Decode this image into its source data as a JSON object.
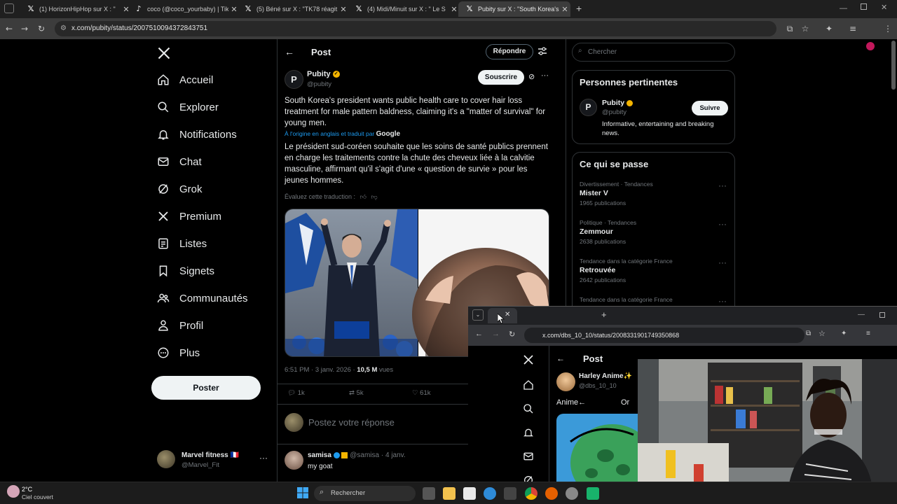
{
  "browser": {
    "tabs": [
      {
        "title": "(1) HorizonHipHop sur X : \"",
        "icon": "x-icon"
      },
      {
        "title": "coco (@coco_yourbaby) | TikTok",
        "icon": "tiktok-icon"
      },
      {
        "title": "(5) Béné sur X : \"TK78 réagit à l",
        "icon": "x-icon"
      },
      {
        "title": "(4) Midi/Minuit sur X : \" Le S",
        "icon": "x-icon"
      },
      {
        "title": "Pubity sur X : \"South Korea's pr",
        "icon": "x-icon"
      }
    ],
    "url": "x.com/pubity/status/2007510094372843751"
  },
  "sidebar": {
    "items": [
      {
        "label": "Accueil",
        "icon": "home-icon"
      },
      {
        "label": "Explorer",
        "icon": "search-icon"
      },
      {
        "label": "Notifications",
        "icon": "bell-icon"
      },
      {
        "label": "Chat",
        "icon": "mail-icon"
      },
      {
        "label": "Grok",
        "icon": "grok-icon"
      },
      {
        "label": "Premium",
        "icon": "x-icon"
      },
      {
        "label": "Listes",
        "icon": "list-icon"
      },
      {
        "label": "Signets",
        "icon": "bookmark-icon"
      },
      {
        "label": "Communautés",
        "icon": "people-icon"
      },
      {
        "label": "Profil",
        "icon": "person-icon"
      },
      {
        "label": "Plus",
        "icon": "more-circle-icon"
      }
    ],
    "post_button": "Poster",
    "account": {
      "name": "Marvel fitness 🇫🇷",
      "handle": "@Marvel_Fit"
    }
  },
  "post": {
    "header_title": "Post",
    "reply_button": "Répondre",
    "author_name": "Pubity",
    "author_handle": "@pubity",
    "subscribe_button": "Souscrire",
    "original_text": "South Korea's president wants public health care to cover hair loss treatment for male pattern baldness, claiming it's a \"matter of survival\" for young men.",
    "translation_note": "À l'origine en anglais et traduit par",
    "translation_provider": "Google",
    "translated_text": "Le président sud-coréen souhaite que les soins de santé publics prennent en charge les traitements contre la chute des cheveux liée à la calvitie masculine, affirmant qu'il s'agit d'une « question de survie » pour les jeunes hommes.",
    "rate_translation": "Évaluez cette traduction :",
    "timestamp": "6:51 PM · 3 janv. 2026 · ",
    "views_count": "10,5 M",
    "views_label": " vues",
    "replies": "1k",
    "reposts": "5k",
    "likes": "61k",
    "reply_placeholder": "Postez votre réponse",
    "first_reply": {
      "name": "samisa",
      "handle": "@samisa · 4 janv.",
      "text": "my goat"
    }
  },
  "right": {
    "search_placeholder": "Chercher",
    "relevant_title": "Personnes pertinentes",
    "relevant": {
      "name": "Pubity",
      "handle": "@pubity",
      "bio": "Informative, entertaining and breaking news.",
      "follow": "Suivre"
    },
    "trends_title": "Ce qui se passe",
    "trends": [
      {
        "category": "Divertissement · Tendances",
        "name": "Mister V",
        "count": "1965 publications"
      },
      {
        "category": "Politique · Tendances",
        "name": "Zemmour",
        "count": "2638 publications"
      },
      {
        "category": "Tendance dans la catégorie France",
        "name": "Retrouvée",
        "count": "2642 publications"
      },
      {
        "category": "Tendance dans la catégorie France",
        "name": "",
        "count": ""
      }
    ]
  },
  "second_window": {
    "url": "x.com/dbs_10_10/status/2008331901749350868",
    "header_title": "Post",
    "author_name": "Harley Anime✨",
    "author_handle": "@dbs_10_10",
    "text_left": "Anime←",
    "text_right": "Or"
  },
  "taskbar": {
    "weather_temp": "2°C",
    "weather_desc": "Ciel couvert",
    "search_label": "Rechercher"
  },
  "colors": {
    "verified": "#f4b400",
    "link": "#1d9bf0",
    "accent_bg": "#000000"
  }
}
